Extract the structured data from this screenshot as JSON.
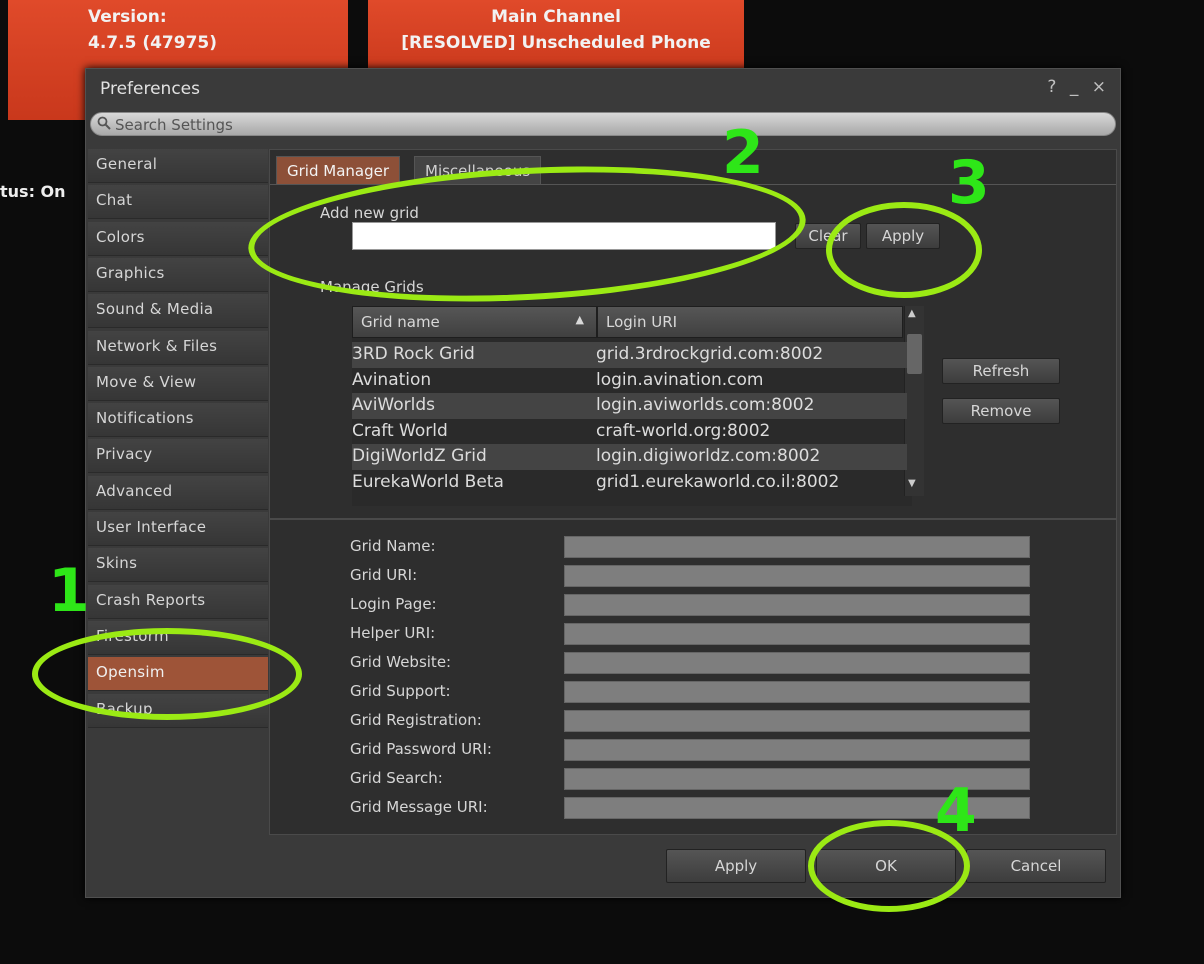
{
  "background": {
    "version_label": "Version:",
    "version_value": "4.7.5 (47975)",
    "channel_label": "Main Channel",
    "channel_value": "[RESOLVED] Unscheduled Phone",
    "status_partial": "tus: On"
  },
  "dialog": {
    "title": "Preferences",
    "title_buttons": "? _ ×",
    "search_placeholder": "Search Settings"
  },
  "sidebar": {
    "items": [
      {
        "label": "General"
      },
      {
        "label": "Chat"
      },
      {
        "label": "Colors"
      },
      {
        "label": "Graphics"
      },
      {
        "label": "Sound & Media"
      },
      {
        "label": "Network & Files"
      },
      {
        "label": "Move & View"
      },
      {
        "label": "Notifications"
      },
      {
        "label": "Privacy"
      },
      {
        "label": "Advanced"
      },
      {
        "label": "User Interface"
      },
      {
        "label": "Skins"
      },
      {
        "label": "Crash Reports"
      },
      {
        "label": "Firestorm"
      },
      {
        "label": "Opensim"
      },
      {
        "label": "Backup"
      }
    ],
    "active": "Opensim"
  },
  "tabs": {
    "grid_manager": "Grid Manager",
    "miscellaneous": "Miscellaneous"
  },
  "grid_manager": {
    "add_new_grid_label": "Add new grid",
    "add_new_grid_value": "",
    "clear_label": "Clear",
    "apply_label": "Apply",
    "manage_grids_label": "Manage Grids",
    "refresh_label": "Refresh",
    "remove_label": "Remove",
    "columns": {
      "name": "Grid name",
      "uri": "Login URI"
    },
    "rows": [
      {
        "name": "3RD Rock Grid",
        "uri": "grid.3rdrockgrid.com:8002"
      },
      {
        "name": "Avination",
        "uri": "login.avination.com"
      },
      {
        "name": "AviWorlds",
        "uri": "login.aviworlds.com:8002"
      },
      {
        "name": "Craft World",
        "uri": "craft-world.org:8002"
      },
      {
        "name": "DigiWorldZ Grid",
        "uri": "login.digiworldz.com:8002"
      },
      {
        "name": "EurekaWorld Beta",
        "uri": "grid1.eurekaworld.co.il:8002"
      }
    ],
    "details": [
      {
        "label": "Grid Name:"
      },
      {
        "label": "Grid URI:"
      },
      {
        "label": "Login Page:"
      },
      {
        "label": "Helper URI:"
      },
      {
        "label": "Grid Website:"
      },
      {
        "label": "Grid Support:"
      },
      {
        "label": "Grid Registration:"
      },
      {
        "label": "Grid Password URI:"
      },
      {
        "label": "Grid Search:"
      },
      {
        "label": "Grid Message URI:"
      }
    ]
  },
  "footer": {
    "apply_label": "Apply",
    "ok_label": "OK",
    "cancel_label": "Cancel"
  },
  "annotations": {
    "step1": "1",
    "step2": "2",
    "step3": "3",
    "step4": "4",
    "color": "#2ee618"
  }
}
